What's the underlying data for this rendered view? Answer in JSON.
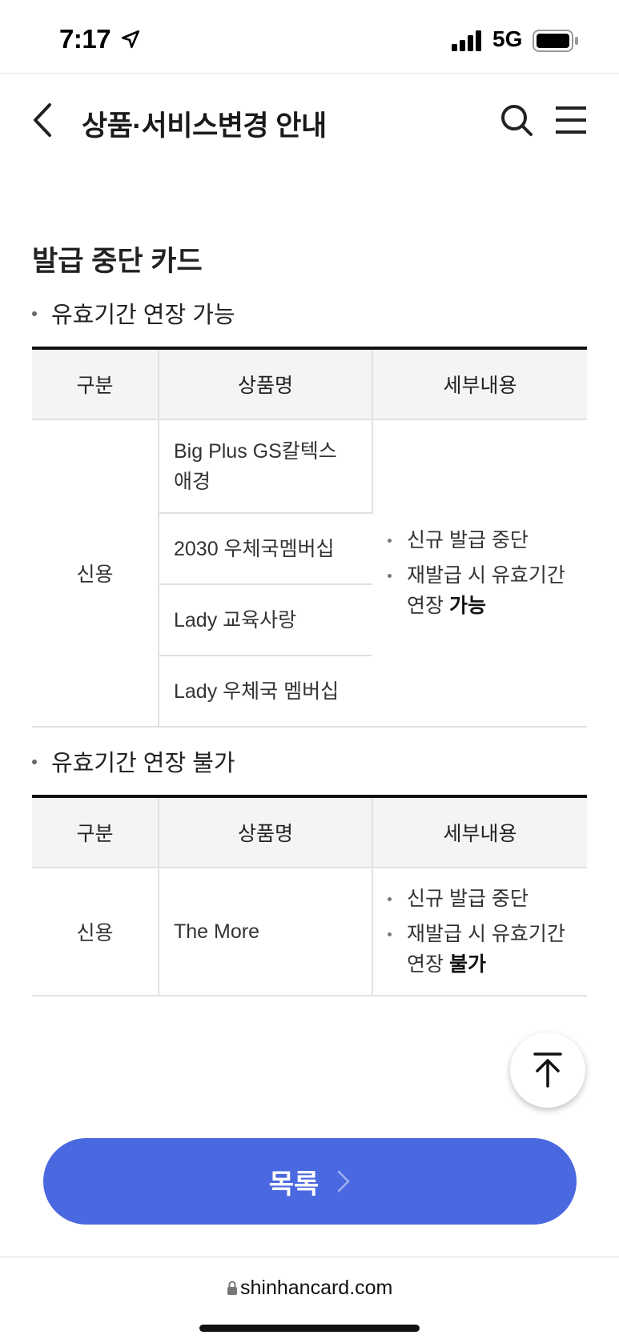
{
  "status_bar": {
    "time": "7:17",
    "network": "5G"
  },
  "header": {
    "title": "상품·서비스변경 안내"
  },
  "section": {
    "title": "발급 중단 카드"
  },
  "table1": {
    "subtitle": "유효기간 연장 가능",
    "headers": [
      "구분",
      "상품명",
      "세부내용"
    ],
    "category": "신용",
    "products": [
      "Big Plus GS칼텍스 애경",
      "2030 우체국멤버십",
      "Lady 교육사랑",
      "Lady 우체국 멤버십"
    ],
    "detail_line1": "신규 발급 중단",
    "detail_line2_prefix": "재발급 시 유효기간 연장",
    "detail_line2_bold": "가능"
  },
  "table2": {
    "subtitle": "유효기간 연장 불가",
    "headers": [
      "구분",
      "상품명",
      "세부내용"
    ],
    "category": "신용",
    "product": "The More",
    "detail_line1": "신규 발급 중단",
    "detail_line2_prefix": "재발급 시 유효기간 연장",
    "detail_line2_bold": "불가"
  },
  "list_button": {
    "label": "목록"
  },
  "browser": {
    "url": "shinhancard.com"
  },
  "colors": {
    "accent": "#4a68e0",
    "table_header_bg": "#f4f4f4"
  },
  "icons": [
    "location-arrow-icon",
    "signal-icon",
    "battery-icon",
    "back-chevron-icon",
    "search-icon",
    "menu-icon",
    "arrow-up-icon",
    "chevron-right-icon",
    "lock-icon"
  ]
}
